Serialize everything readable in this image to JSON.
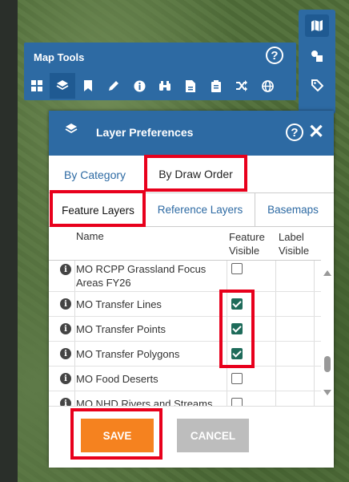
{
  "map_tools": {
    "title": "Map Tools",
    "help_label": "?",
    "icons": [
      "grid-icon",
      "layers-icon",
      "bookmark-icon",
      "pencil-icon",
      "info-icon",
      "binoculars-icon",
      "document-icon",
      "clipboard-icon",
      "shuffle-icon",
      "globe-icon"
    ]
  },
  "right_toolbar": {
    "icons": [
      "map-icon",
      "shapes-icon",
      "tag-icon"
    ]
  },
  "layer_preferences": {
    "title": "Layer Preferences",
    "help_label": "?",
    "close_label": "✕",
    "tabs_row1": [
      {
        "label": "By Category",
        "active": false
      },
      {
        "label": "By Draw Order",
        "active": true
      }
    ],
    "tabs_row2": [
      {
        "label": "Feature Layers",
        "active": true
      },
      {
        "label": "Reference Layers",
        "active": false
      },
      {
        "label": "Basemaps",
        "active": false
      }
    ],
    "grid": {
      "columns": [
        "Name",
        "Feature Visible",
        "Label Visible"
      ],
      "col_name": "Name",
      "col_feature_line1": "Feature",
      "col_feature_line2": "Visible",
      "col_label_line1": "Label",
      "col_label_line2": "Visible",
      "rows": [
        {
          "name": "MO RCPP Grassland Focus Areas FY26",
          "feature_visible": false
        },
        {
          "name": "MO Transfer Lines",
          "feature_visible": true
        },
        {
          "name": "MO Transfer Points",
          "feature_visible": true
        },
        {
          "name": "MO Transfer Polygons",
          "feature_visible": true
        },
        {
          "name": "MO Food Deserts",
          "feature_visible": false
        },
        {
          "name": "MO NHD Rivers and Streams",
          "feature_visible": false
        }
      ]
    },
    "save_label": "SAVE",
    "cancel_label": "CANCEL"
  },
  "colors": {
    "header_blue": "#2d6aa3",
    "save_orange": "#f5821f",
    "cancel_gray": "#bdbdbd",
    "check_green": "#1e6b5a",
    "highlight_red": "#e8001c"
  }
}
